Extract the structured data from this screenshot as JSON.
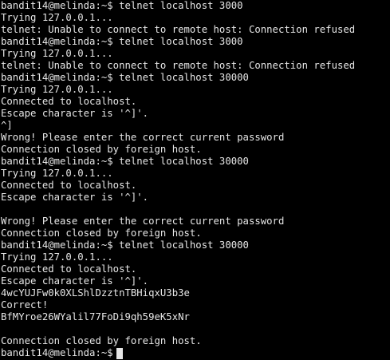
{
  "terminal": {
    "lines": [
      "bandit14@melinda:~$ telnet localhost 3000",
      "Trying 127.0.0.1...",
      "telnet: Unable to connect to remote host: Connection refused",
      "bandit14@melinda:~$ telnet localhost 3000",
      "Trying 127.0.0.1...",
      "telnet: Unable to connect to remote host: Connection refused",
      "bandit14@melinda:~$ telnet localhost 30000",
      "Trying 127.0.0.1...",
      "Connected to localhost.",
      "Escape character is '^]'.",
      "^]",
      "Wrong! Please enter the correct current password",
      "Connection closed by foreign host.",
      "bandit14@melinda:~$ telnet localhost 30000",
      "Trying 127.0.0.1...",
      "Connected to localhost.",
      "Escape character is '^]'.",
      "",
      "Wrong! Please enter the correct current password",
      "Connection closed by foreign host.",
      "bandit14@melinda:~$ telnet localhost 30000",
      "Trying 127.0.0.1...",
      "Connected to localhost.",
      "Escape character is '^]'.",
      "4wcYUJFw0k0XLShlDzztnTBHiqxU3b3e",
      "Correct!",
      "BfMYroe26WYalil77FoDi9qh59eK5xNr",
      "",
      "Connection closed by foreign host."
    ],
    "current_prompt": "bandit14@melinda:~$"
  },
  "colors": {
    "background": "#000000",
    "foreground": "#e6e6e6"
  }
}
